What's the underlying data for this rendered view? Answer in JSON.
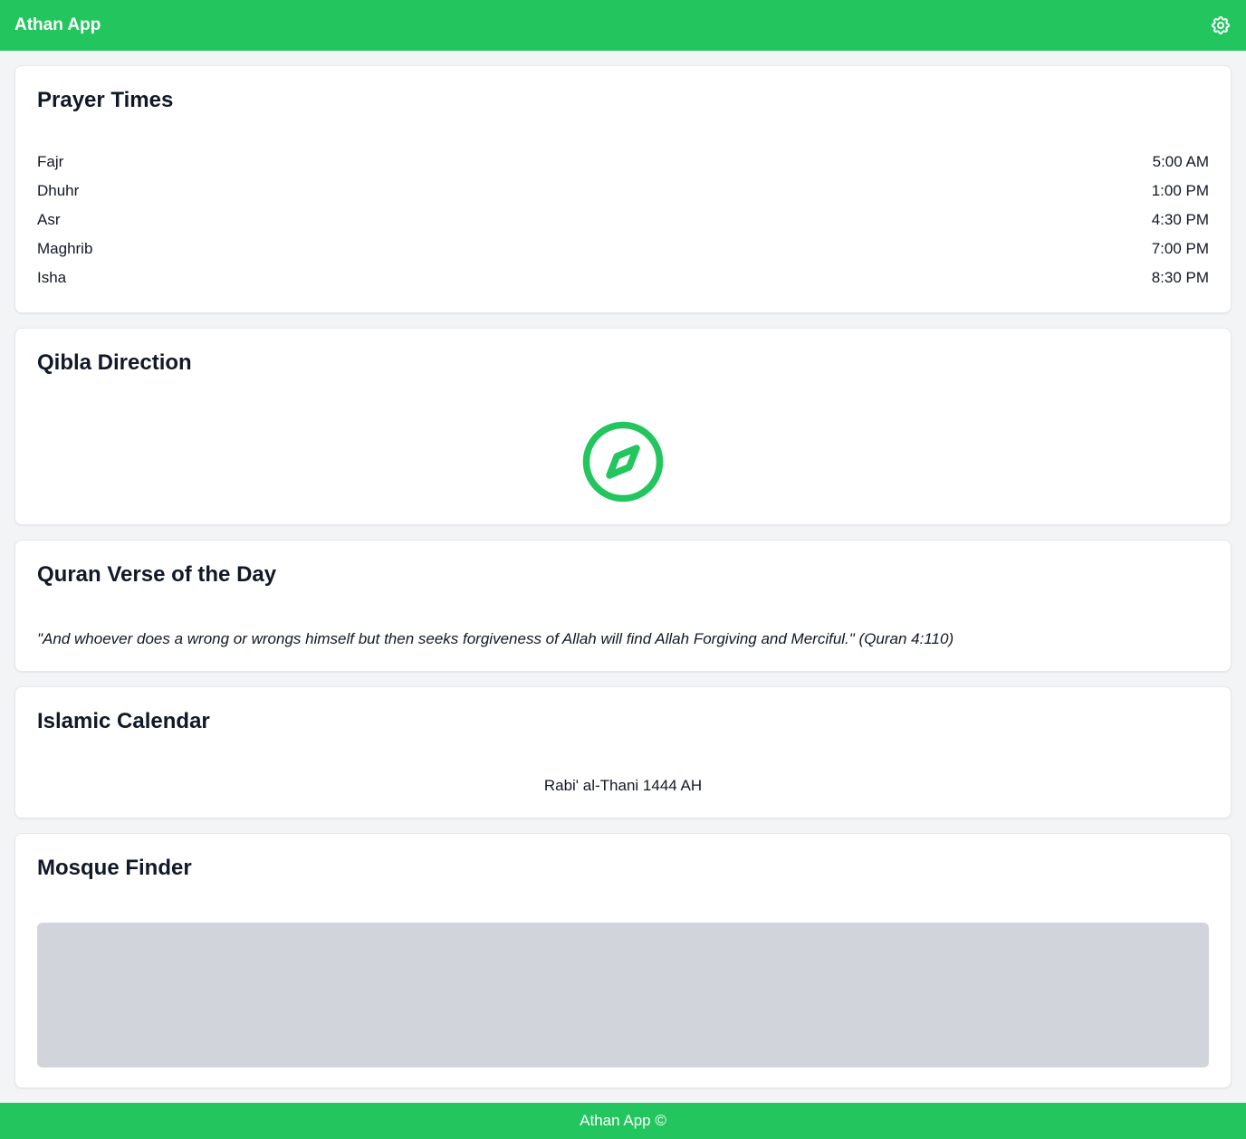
{
  "header": {
    "title": "Athan App",
    "settings_icon": "gear-icon"
  },
  "prayer_times": {
    "title": "Prayer Times",
    "rows": [
      {
        "name": "Fajr",
        "time": "5:00 AM"
      },
      {
        "name": "Dhuhr",
        "time": "1:00 PM"
      },
      {
        "name": "Asr",
        "time": "4:30 PM"
      },
      {
        "name": "Maghrib",
        "time": "7:00 PM"
      },
      {
        "name": "Isha",
        "time": "8:30 PM"
      }
    ]
  },
  "qibla": {
    "title": "Qibla Direction",
    "icon": "compass-icon"
  },
  "verse": {
    "title": "Quran Verse of the Day",
    "text": "\"And whoever does a wrong or wrongs himself but then seeks forgiveness of Allah will find Allah Forgiving and Merciful.\" (Quran 4:110)"
  },
  "calendar": {
    "title": "Islamic Calendar",
    "date": "Rabi' al-Thani 1444 AH"
  },
  "mosque_finder": {
    "title": "Mosque Finder"
  },
  "footer": {
    "text": "Athan App ©"
  },
  "colors": {
    "brand": "#22c55e",
    "background": "#f3f4f6",
    "map_placeholder": "#d1d5db"
  }
}
